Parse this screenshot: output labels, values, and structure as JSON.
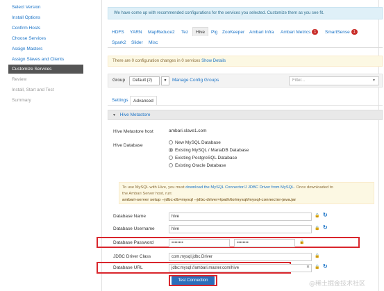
{
  "sidebar": {
    "items": [
      {
        "label": "Select Version",
        "state": "link"
      },
      {
        "label": "Install Options",
        "state": "link"
      },
      {
        "label": "Confirm Hosts",
        "state": "link"
      },
      {
        "label": "Choose Services",
        "state": "link"
      },
      {
        "label": "Assign Masters",
        "state": "link"
      },
      {
        "label": "Assign Slaves and Clients",
        "state": "link"
      },
      {
        "label": "Customize Services",
        "state": "active"
      },
      {
        "label": "Review",
        "state": "disabled"
      },
      {
        "label": "Install, Start and Test",
        "state": "disabled"
      },
      {
        "label": "Summary",
        "state": "disabled"
      }
    ]
  },
  "info_text": "We have come up with recommended configurations for the services you selected. Customize them as you see fit.",
  "service_tabs": [
    {
      "label": "HDFS"
    },
    {
      "label": "YARN"
    },
    {
      "label": "MapReduce2"
    },
    {
      "label": "Tez"
    },
    {
      "label": "Hive",
      "active": true
    },
    {
      "label": "Pig"
    },
    {
      "label": "ZooKeeper"
    },
    {
      "label": "Ambari Infra"
    },
    {
      "label": "Ambari Metrics",
      "badge": "1"
    },
    {
      "label": "SmartSense",
      "badge": "1"
    },
    {
      "label": "Spark2"
    },
    {
      "label": "Slider"
    },
    {
      "label": "Misc"
    }
  ],
  "warning": {
    "text": "There are 0 configuration changes in 0 services",
    "link": "Show Details"
  },
  "group": {
    "label": "Group",
    "selected": "Default (2)",
    "manage_link": "Manage Config Groups",
    "filter_placeholder": "Filter..."
  },
  "sub_tabs": {
    "settings": "Settings",
    "advanced": "Advanced"
  },
  "section": {
    "title": "Hive Metastore"
  },
  "metastore": {
    "host_label": "Hive Metastore host",
    "host_value": "ambari.slave1.com",
    "db_label": "Hive Database",
    "db_options": [
      {
        "label": "New MySQL Database",
        "checked": false
      },
      {
        "label": "Existing MySQL / MariaDB Database",
        "checked": true
      },
      {
        "label": "Existing PostgreSQL Database",
        "checked": false
      },
      {
        "label": "Existing Oracle Database",
        "checked": false
      }
    ]
  },
  "note": {
    "line1_pre": "To use MySQL with Hive, you must",
    "line1_link": "download the MySQL Connector/J JDBC Driver from MySQL",
    "line1_post": ". Once downloaded to",
    "line2": "the Ambari Server host, run:",
    "line3": "ambari-server setup --jdbc-db=mysql --jdbc-driver=/path/to/mysql/mysql-connector-java.jar"
  },
  "fields": {
    "db_name": {
      "label": "Database Name",
      "value": "hive"
    },
    "db_username": {
      "label": "Database Username",
      "value": "hive"
    },
    "db_password": {
      "label": "Database Password",
      "value": "••••••••",
      "confirm": "••••••••"
    },
    "jdbc_class": {
      "label": "JDBC Driver Class",
      "value": "com.mysql.jdbc.Driver"
    },
    "db_url": {
      "label": "Database URL",
      "value": "jdbc:mysql://ambari.master.com/hive"
    }
  },
  "test_button": "Test Connection",
  "watermark": "@稀土掘金技术社区",
  "colors": {
    "link": "#1a73c7",
    "active_sidebar": "#555555",
    "highlight_box": "#d9262c",
    "primary_button": "#2a6ebb"
  }
}
